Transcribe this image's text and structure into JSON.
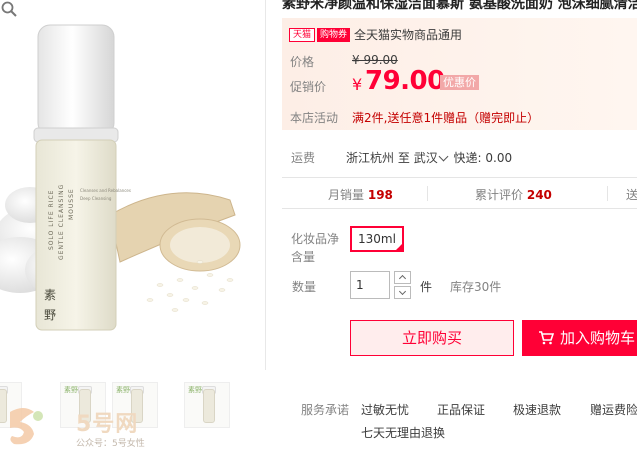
{
  "title": {
    "text": "素野米净颜温和保湿洁面慕斯 氨基酸洗面奶 泡沫细腻清洁毛孔"
  },
  "price_panel": {
    "tmall_tag": "天猫",
    "coupon_tag": "购物券",
    "coupon_text": "全天猫实物商品通用",
    "price_label": "价格",
    "original_price": "¥ 99.00",
    "promo_label": "促销价",
    "currency": "¥",
    "promo_price": "79.00",
    "promo_badge": "优惠价",
    "activity_label": "本店活动",
    "activity_text": "满2件,送任意1件赠品（赠完即止）",
    "accent_color": "#ff0036"
  },
  "shipping": {
    "label": "运费",
    "origin": "浙江杭州",
    "to": "至",
    "destination": "武汉",
    "express": "快递: 0.00"
  },
  "stats": {
    "monthly_sales_label": "月销量",
    "monthly_sales": "198",
    "reviews_label": "累计评价",
    "reviews": "240",
    "third_label": "送"
  },
  "spec": {
    "label": "化妆品净含量",
    "selected": "130ml"
  },
  "quantity": {
    "label": "数量",
    "value": "1",
    "unit": "件",
    "stock": "库存30件"
  },
  "buttons": {
    "buy_now": "立即购买",
    "add_to_cart": "加入购物车"
  },
  "service": {
    "label": "服务承诺",
    "items": [
      "过敏无忧",
      "正品保证",
      "极速退款",
      "赠运费险",
      "七天无理由退换"
    ]
  },
  "product_image": {
    "bottle_text_line1": "SOLO LIFE RICE",
    "bottle_text_line2": "GENTLE CLEANSING",
    "bottle_text_line3": "MOUSSE",
    "bottle_small1": "Cleanses and Rebalances",
    "bottle_small2": "Deep Cleansing",
    "brand_char1": "素",
    "brand_char2": "野",
    "thumb_brand": "素野"
  },
  "watermark": {
    "logo_text": "5号网",
    "sub_text": "公众号：5号女性"
  },
  "icons": [
    "zoom-icon",
    "cart-icon",
    "chevron-down-icon",
    "check-icon"
  ]
}
